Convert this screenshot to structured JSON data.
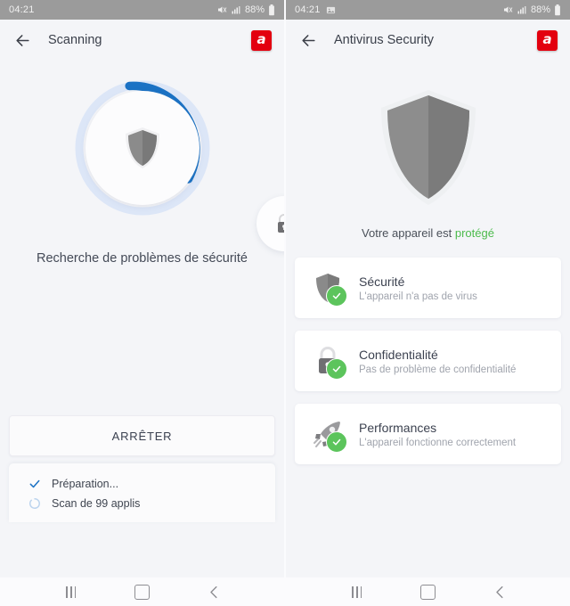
{
  "statusbar": {
    "time": "04:21",
    "battery_percent": "88%",
    "icons": [
      "image-icon",
      "mute-icon",
      "signal-bars-icon",
      "battery-icon"
    ]
  },
  "left": {
    "header": {
      "title": "Scanning",
      "back_icon": "back-arrow-icon",
      "logo_letter": "a"
    },
    "scan": {
      "progress_percent": 47,
      "ring_track_color": "#d9e4f6",
      "ring_progress_color": "#1b72c4",
      "status_text": "Recherche de problèmes de sécurité",
      "center_icon": "shield-icon",
      "peek_card_icon": "lock-icon"
    },
    "stop_button": "ARRÊTER",
    "progress_items": [
      {
        "icon": "check-icon",
        "label": "Préparation..."
      },
      {
        "icon": "spinner-icon",
        "label": "Scan de 99 applis"
      }
    ]
  },
  "right": {
    "header": {
      "title": "Antivirus Security",
      "back_icon": "back-arrow-icon",
      "logo_letter": "a"
    },
    "hero": {
      "icon": "shield-icon"
    },
    "status_prefix": "Votre appareil est ",
    "status_highlight": "protégé",
    "status_highlight_color": "#4cbb4c",
    "cards": [
      {
        "icon": "shield-icon",
        "badge_icon": "check-badge-icon",
        "title": "Sécurité",
        "subtitle": "L'appareil n'a pas de virus"
      },
      {
        "icon": "lock-icon",
        "badge_icon": "check-badge-icon",
        "title": "Confidentialité",
        "subtitle": "Pas de problème de confidentialité"
      },
      {
        "icon": "rocket-icon",
        "badge_icon": "check-badge-icon",
        "title": "Performances",
        "subtitle": "L'appareil fonctionne correctement"
      }
    ]
  },
  "navbar": {
    "recents_label": "recents",
    "home_label": "home",
    "back_label": "back"
  }
}
